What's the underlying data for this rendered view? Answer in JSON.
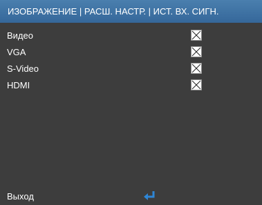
{
  "header": {
    "title": "ИЗОБРАЖЕНИЕ | РАСШ. НАСТР. | ИСТ. ВХ. СИГН."
  },
  "sources": [
    {
      "label": "Видео",
      "checked": true
    },
    {
      "label": "VGA",
      "checked": true
    },
    {
      "label": "S-Video",
      "checked": true
    },
    {
      "label": "HDMI",
      "checked": true
    }
  ],
  "footer": {
    "exit_label": "Выход",
    "enter_icon": "enter-return-arrow"
  },
  "colors": {
    "title_bar": "#3f73a4",
    "background": "#3d3d3d",
    "accent_icon": "#2e86d6"
  }
}
